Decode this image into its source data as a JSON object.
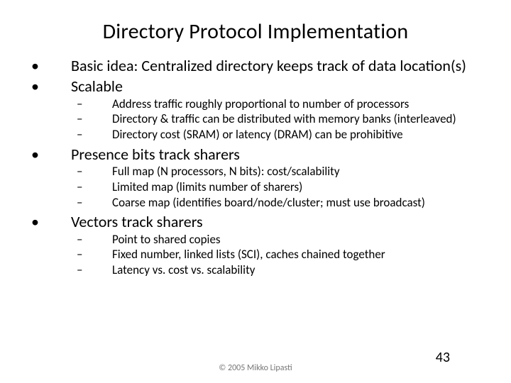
{
  "slide": {
    "title": "Directory Protocol Implementation",
    "bullets": [
      {
        "text": "Basic idea: Centralized directory keeps track of data location(s)",
        "sub": []
      },
      {
        "text": "Scalable",
        "sub": [
          "Address traffic roughly proportional to number of processors",
          "Directory & traffic can be distributed with memory banks (interleaved)",
          "Directory cost (SRAM) or latency (DRAM) can be prohibitive"
        ]
      },
      {
        "text": "Presence bits track sharers",
        "sub": [
          "Full map (N processors, N bits): cost/scalability",
          "Limited map (limits number of sharers)",
          "Coarse map (identifies board/node/cluster; must use broadcast)"
        ]
      },
      {
        "text": "Vectors track sharers",
        "sub": [
          "Point to shared copies",
          "Fixed number, linked lists (SCI), caches chained together",
          "Latency vs. cost vs. scalability"
        ]
      }
    ],
    "copyright": "© 2005 Mikko Lipasti",
    "page_number": "43"
  }
}
